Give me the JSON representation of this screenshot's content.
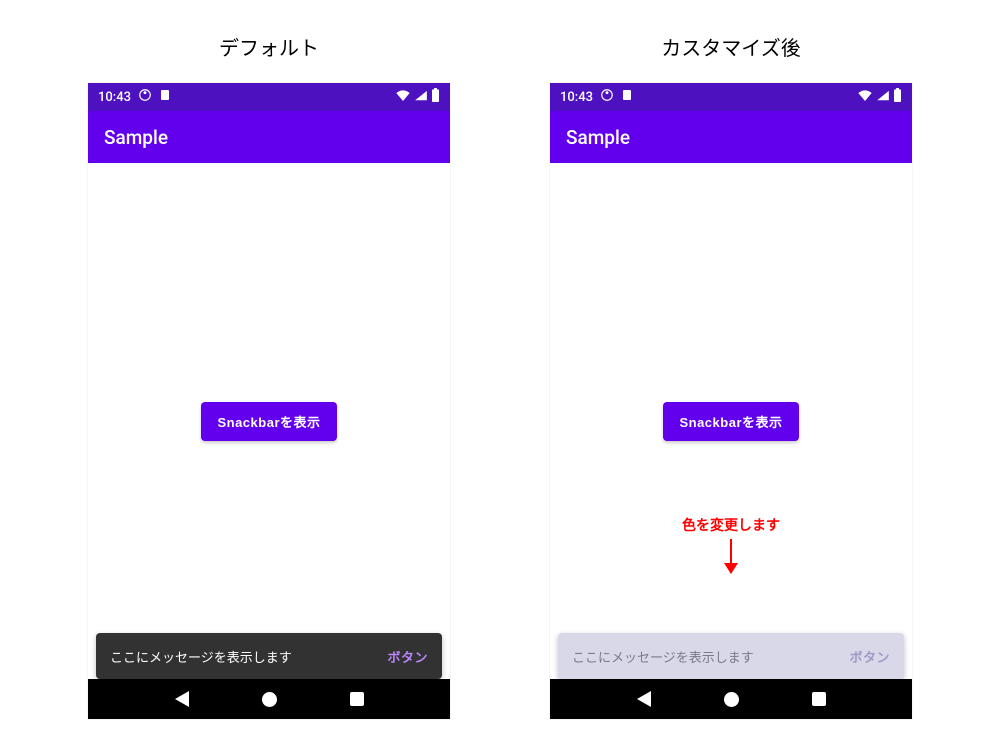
{
  "labels": {
    "default_title": "デフォルト",
    "custom_title": "カスタマイズ後"
  },
  "status": {
    "time": "10:43"
  },
  "app": {
    "title": "Sample",
    "button_label": "Snackbarを表示"
  },
  "snackbar": {
    "message": "ここにメッセージを表示します",
    "action": "ボタン"
  },
  "annotation": {
    "text": "色を変更します"
  },
  "colors": {
    "primary": "#6200EE",
    "status_bar": "#4D11C0",
    "snackbar_dark_bg": "#323232",
    "snackbar_light_bg": "#D8D8E8",
    "snackbar_action_dark": "#BB86FC",
    "annotation": "#ff0000"
  }
}
